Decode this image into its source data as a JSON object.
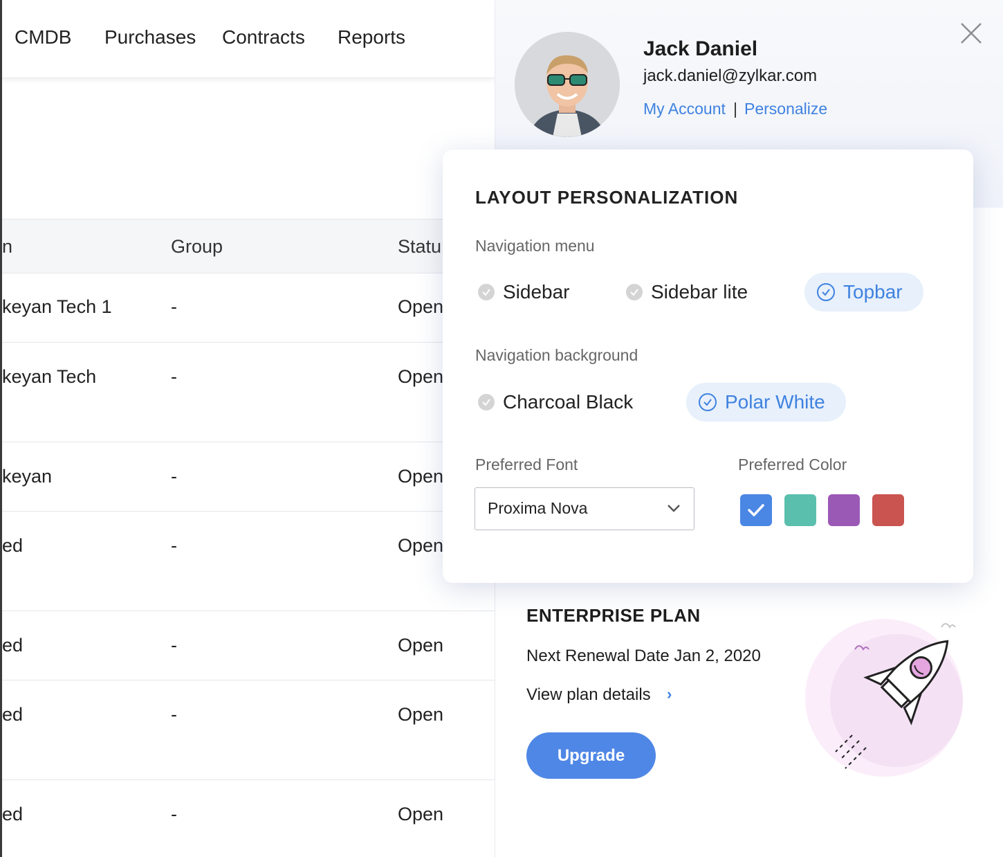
{
  "topnav": {
    "items": [
      "CMDB",
      "Purchases",
      "Contracts",
      "Reports"
    ]
  },
  "table": {
    "headers": [
      "n",
      "Group",
      "Statu"
    ],
    "rows": [
      {
        "name": "keyan Tech 1",
        "group": "-",
        "status": "Open"
      },
      {
        "name": "keyan Tech",
        "group": "-",
        "status": "Open"
      },
      {
        "name": "keyan",
        "group": "-",
        "status": "Open"
      },
      {
        "name": "ed",
        "group": "-",
        "status": "Open"
      },
      {
        "name": "ed",
        "group": "-",
        "status": "Open"
      },
      {
        "name": "ed",
        "group": "-",
        "status": "Open"
      },
      {
        "name": "ed",
        "group": "-",
        "status": "Open"
      }
    ]
  },
  "profile": {
    "name": "Jack Daniel",
    "email": "jack.daniel@zylkar.com",
    "my_account": "My Account",
    "separator": "|",
    "personalize": "Personalize"
  },
  "personalization": {
    "title": "LAYOUT PERSONALIZATION",
    "nav_menu_label": "Navigation menu",
    "nav_menu_options": [
      "Sidebar",
      "Sidebar lite",
      "Topbar"
    ],
    "nav_menu_selected": "Topbar",
    "nav_bg_label": "Navigation background",
    "nav_bg_options": [
      "Charcoal Black",
      "Polar White"
    ],
    "nav_bg_selected": "Polar White",
    "font_label": "Preferred Font",
    "font_value": "Proxima Nova",
    "color_label": "Preferred Color",
    "colors": [
      "#4a86e4",
      "#5bbfae",
      "#9b59b6",
      "#c95450"
    ],
    "color_selected": "#4a86e4"
  },
  "plan": {
    "title": "ENTERPRISE PLAN",
    "renewal": "Next Renewal Date Jan 2, 2020",
    "details_link": "View plan details",
    "chevron": "›",
    "upgrade_label": "Upgrade"
  }
}
